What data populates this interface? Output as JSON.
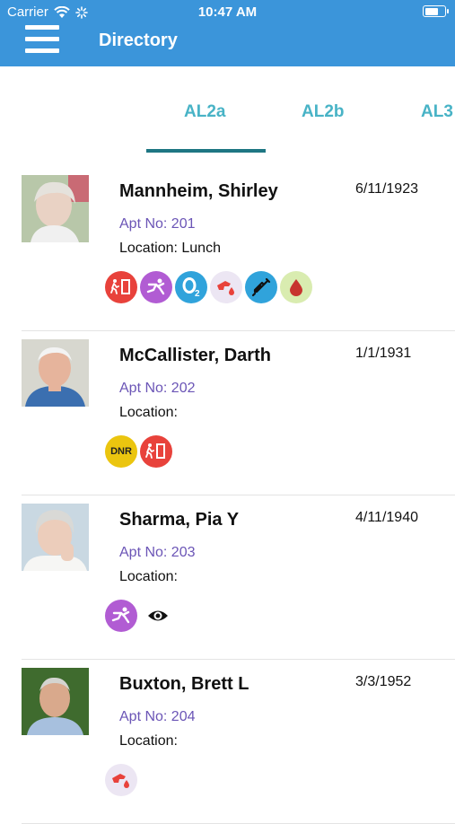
{
  "status_bar": {
    "carrier": "Carrier",
    "time": "10:47 AM",
    "battery_level": 0.7
  },
  "navbar": {
    "title": "Directory"
  },
  "tabs": [
    {
      "label": "AL2a",
      "selected": true
    },
    {
      "label": "AL2b",
      "selected": false
    },
    {
      "label": "AL3",
      "selected": false
    }
  ],
  "colors": {
    "primary": "#3b95da",
    "tab_text": "#48b3c6",
    "tab_indicator": "#1e7683",
    "apt_text": "#6b55b6"
  },
  "residents": [
    {
      "name": "Mannheim, Shirley",
      "dob": "6/11/1923",
      "apt": "Apt No: 201",
      "location": "Location: Lunch",
      "icons": [
        "exit-icon",
        "fall-risk-icon",
        "oxygen-icon",
        "diabetic-icon",
        "injection-icon",
        "blood-icon"
      ]
    },
    {
      "name": "McCallister, Darth",
      "dob": "1/1/1931",
      "apt": "Apt No: 202",
      "location": "Location:",
      "dnr_label": "DNR",
      "icons": [
        "dnr-icon",
        "exit-icon"
      ]
    },
    {
      "name": "Sharma, Pia Y",
      "dob": "4/11/1940",
      "apt": "Apt No: 203",
      "location": "Location:",
      "icons": [
        "fall-risk-icon",
        "eye-icon"
      ]
    },
    {
      "name": "Buxton, Brett L",
      "dob": "3/3/1952",
      "apt": "Apt No: 204",
      "location": "Location:",
      "icons": [
        "diabetic-icon"
      ]
    }
  ]
}
